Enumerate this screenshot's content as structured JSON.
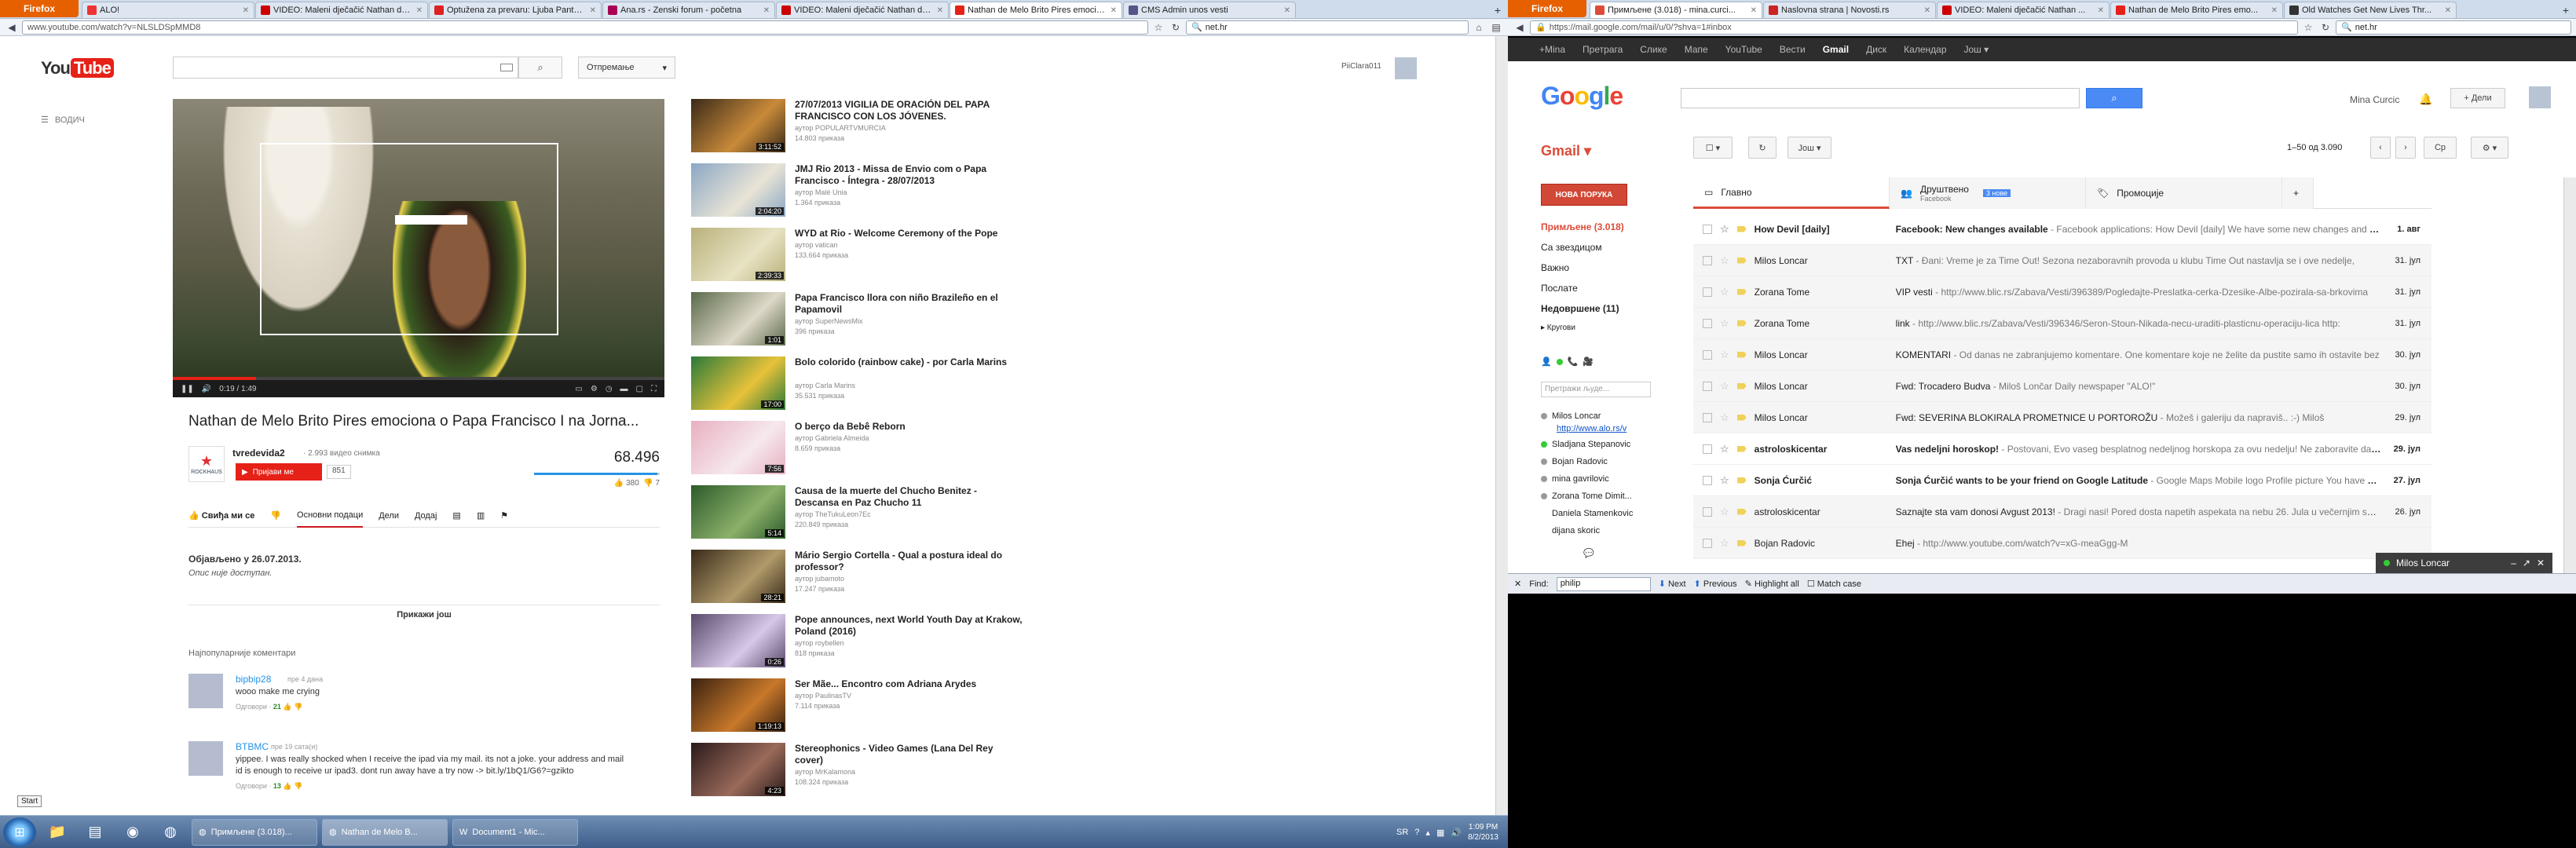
{
  "left": {
    "browser": {
      "firefox_label": "Firefox",
      "tabs": [
        {
          "title": "ALO!",
          "color": "#e33"
        },
        {
          "title": "VIDEO: Maleni dječačić Nathan de ...",
          "color": "#c00"
        },
        {
          "title": "Optužena za prevaru: Ljuba Pantovi...",
          "color": "#d22"
        },
        {
          "title": "Ana.rs - Zenski forum - početna",
          "color": "#a05"
        },
        {
          "title": "VIDEO: Maleni dječačić Nathan de ...",
          "color": "#c00"
        },
        {
          "title": "Nathan de Melo Brito Pires emocio...",
          "color": "#e62117",
          "active": true
        },
        {
          "title": "CMS Admin unos vesti",
          "color": "#558"
        }
      ],
      "url": "www.youtube.com/watch?v=NLSLDSpMMD8",
      "search_value": "net.hr"
    },
    "youtube": {
      "logo_you": "You",
      "logo_tube": "Tube",
      "upload_label": "Отпремање",
      "user_name": "PiiClara011",
      "menu_label": "ВОДИЧ",
      "player": {
        "time": "0:19 / 1:49",
        "progress": 0.17
      },
      "title": "Nathan de Melo Brito Pires emociona o Papa Francisco I na Jorna...",
      "channel": {
        "logo_text": "ROCKHAUS",
        "name": "tvredevida2",
        "videos": "· 2.993 видео снимка",
        "subscribe": "Пријави ме",
        "subs": "851",
        "views": "68.496",
        "likes": "380",
        "dislikes": "7",
        "like_ratio": 0.98
      },
      "actions": {
        "like": "Свиђа ми се",
        "about": "Основни подаци",
        "share": "Дели",
        "add": "Додај"
      },
      "published": "Објављено у 26.07.2013.",
      "description": "Опис није доступан.",
      "show_more": "Прикажи још",
      "comments_header": "Најпопуларније коментари",
      "comments": [
        {
          "user": "bipbip28",
          "ago": "пре 4 дана",
          "text": "wooo make me crying",
          "reply": "Одговори ·",
          "score": "21"
        },
        {
          "user": "BTBMC",
          "ago": "пре 19 сата(и)",
          "text": "yippee. I was really shocked when I receive the ipad via my mail. its not a joke. your address and mail id is enough to receive ur ipad3. dont run away have a try now -> bit.ly/1bQ1/G6?=gzikto",
          "reply": "Одговори ·",
          "score": "13"
        }
      ],
      "related": [
        {
          "title": "27/07/2013 VIGILIA DE ORACIÓN DEL PAPA FRANCISCO CON LOS JÓVENES.",
          "author": "аутор POPULARTVMURCIA",
          "views": "14.803 приказа",
          "dur": "3:11:52",
          "c1": "#3a2a18",
          "c2": "#c98a3a"
        },
        {
          "title": "JMJ Rio 2013 - Missa de Envio com o Papa Francisco - Íntegra - 28/07/2013",
          "author": "аутор Malé Unia",
          "views": "1.364 приказа",
          "dur": "2:04:20",
          "c1": "#8aa7c4",
          "c2": "#e9e4d6"
        },
        {
          "title": "WYD at Rio - Welcome Ceremony of the Pope",
          "author": "аутор vatican",
          "views": "133.664 приказа",
          "dur": "2:39:33",
          "c1": "#b9b07a",
          "c2": "#e7e3c3"
        },
        {
          "title": "Papa Francisco llora con niño Brazileño en el Papamovil",
          "author": "аутор SuperNewsMix",
          "views": "396 приказа",
          "dur": "1:01",
          "c1": "#5a6a4a",
          "c2": "#ded8c8"
        },
        {
          "title": "Bolo colorido (rainbow cake) - por Carla Marins",
          "author": "аутор Carla Marins",
          "views": "35.531 приказа",
          "dur": "17:00",
          "c1": "#2a7a3a",
          "c2": "#e8c23a"
        },
        {
          "title": "O berço da Bebê Reborn",
          "author": "аутор Gabriela Almeida",
          "views": "8.659 приказа",
          "dur": "7:56",
          "c1": "#e8b0c0",
          "c2": "#f6e8ee"
        },
        {
          "title": "Causa de la muerte del Chucho Benitez - Descansa en Paz Chucho 11",
          "author": "аутор TheTukuLeon7Ec",
          "views": "220.849 приказа",
          "dur": "5:14",
          "c1": "#2c5a2a",
          "c2": "#8bb06a"
        },
        {
          "title": "Mário Sergio Cortella - Qual a postura ideal do professor?",
          "author": "аутор jubamoto",
          "views": "17.247 приказа",
          "dur": "28:21",
          "c1": "#3a2a1a",
          "c2": "#b09a6a"
        },
        {
          "title": "Pope announces, next World Youth Day at Krakow, Poland (2016)",
          "author": "аутор roybellen",
          "views": "818 приказа",
          "dur": "0:26",
          "c1": "#5a4a6a",
          "c2": "#d8c8e8"
        },
        {
          "title": "Ser Mãe... Encontro com Adriana Arydes",
          "author": "аутор PaulinasTV",
          "views": "7.114 приказа",
          "dur": "1:19:13",
          "c1": "#3a2210",
          "c2": "#c8782a"
        },
        {
          "title": "Stereophonics - Video Games (Lana Del Rey cover)",
          "author": "аутор MrKalamona",
          "views": "108.324 приказа",
          "dur": "4:23",
          "c1": "#2a1a1a",
          "c2": "#9a6a5a"
        }
      ],
      "start_label": "Start"
    },
    "taskbar": {
      "apps": [
        {
          "label": "Примљене (3.018)..."
        },
        {
          "label": "Nathan de Melo B...",
          "active": true
        },
        {
          "label": "Document1 - Mic..."
        }
      ],
      "lang": "SR",
      "time": "1:09 PM",
      "date": "8/2/2013"
    }
  },
  "right": {
    "browser": {
      "firefox_label": "Firefox",
      "tabs": [
        {
          "title": "Примљене (3.018) - mina.curci...",
          "color": "#dd4b39",
          "active": true
        },
        {
          "title": "Naslovna strana | Novosti.rs",
          "color": "#c22"
        },
        {
          "title": "VIDEO: Maleni dječačić Nathan ...",
          "color": "#c00"
        },
        {
          "title": "Nathan de Melo Brito Pires emo...",
          "color": "#e62117"
        },
        {
          "title": "Old Watches Get New Lives Thr...",
          "color": "#333"
        }
      ],
      "url": "https://mail.google.com/mail/u/0/?shva=1#inbox",
      "search_value": "net.hr"
    },
    "gbar": [
      "+Mina",
      "Претрага",
      "Слике",
      "Мапе",
      "YouTube",
      "Вести",
      "Gmail",
      "Диск",
      "Календар",
      "Још ▾"
    ],
    "gbar_selected": "Gmail",
    "gmail": {
      "logo": [
        "G",
        "o",
        "o",
        "g",
        "l",
        "e"
      ],
      "logo_colors": [
        "#4285f4",
        "#ea4335",
        "#fbbc05",
        "#4285f4",
        "#34a853",
        "#ea4335"
      ],
      "user": "Mina Curcic",
      "share": "+ Дели",
      "title": "Gmail ▾",
      "more": "Још ▾",
      "pagination": "1–50 од 3.090",
      "lang_btn": "Ср",
      "compose": "НОВА ПОРУКА",
      "nav": [
        {
          "label": "Примљене (3.018)",
          "style": "red"
        },
        {
          "label": "Са звездицом",
          "style": ""
        },
        {
          "label": "Важно",
          "style": ""
        },
        {
          "label": "Послате",
          "style": ""
        },
        {
          "label": "Недовршене (11)",
          "style": "bold"
        },
        {
          "label": "▸ Кругови",
          "style": ""
        }
      ],
      "chat_search": "Претражи људе...",
      "contacts": [
        {
          "name": "Milos Loncar",
          "color": "#999",
          "link": "http://www.alo.rs/v"
        },
        {
          "name": "Sladjana Stepanovic",
          "color": "#3c3"
        },
        {
          "name": "Bojan Radovic",
          "color": "#999"
        },
        {
          "name": "mina gavrilovic",
          "color": "#999"
        },
        {
          "name": "Zorana Tome Dimit...",
          "color": "#999"
        },
        {
          "name": "Daniela Stamenkovic",
          "color": ""
        },
        {
          "name": "dijana skoric",
          "color": ""
        }
      ],
      "tabs": [
        {
          "label": "Главно",
          "sub": ""
        },
        {
          "label": "Друштвено",
          "sub": "Facebook",
          "badge": "3 нове"
        },
        {
          "label": "Промоције",
          "sub": ""
        }
      ],
      "mails": [
        {
          "sender": "How Devil [daily]",
          "subject": "Facebook: New changes available",
          "snippet": " - Facebook applications: How Devil [daily] We have some new changes and feat",
          "date": "1. авг",
          "unread": true
        },
        {
          "sender": "Milos Loncar",
          "subject": "TXT",
          "snippet": " - Đani: Vreme je za Time Out! Sezona nezaboravnih provoda u klubu Time Out nastavlja se i ove nedelje,",
          "date": "31. јул",
          "unread": false
        },
        {
          "sender": "Zorana Tome",
          "subject": "VIP vesti",
          "snippet": " - http://www.blic.rs/Zabava/Vesti/396389/Pogledajte-Preslatka-cerka-Dzesike-Albe-pozirala-sa-brkovima",
          "date": "31. јул",
          "unread": false
        },
        {
          "sender": "Zorana Tome",
          "subject": "link",
          "snippet": " - http://www.blic.rs/Zabava/Vesti/396346/Seron-Stoun-Nikada-necu-uraditi-plasticnu-operaciju-lica http:",
          "date": "31. јул",
          "unread": false
        },
        {
          "sender": "Milos Loncar",
          "subject": "KOMENTARI",
          "snippet": " - Od danas ne zabranjujemo komentare. One komentare koje ne želite da pustite samo ih ostavite bez",
          "date": "30. јул",
          "unread": false
        },
        {
          "sender": "Milos Loncar",
          "subject": "Fwd: Trocadero Budva",
          "snippet": " - Miloš Lončar Daily newspaper \"ALO!\"",
          "date": "30. јул",
          "unread": false
        },
        {
          "sender": "Milos Loncar",
          "subject": "Fwd: SEVERINA BLOKIRALA PROMETNICE U PORTOROŽU",
          "snippet": " - Možeš i galeriju da napraviš.. :-) Miloš",
          "date": "29. јул",
          "unread": false
        },
        {
          "sender": "astroloskicentar",
          "subject": "Vas nedeljni horoskop!",
          "snippet": " - Postovani, Evo vaseg besplatnog nedeljnog horskopa za ovu nedelju! Ne zaboravite da pose",
          "date": "29. јул",
          "unread": true
        },
        {
          "sender": "Sonja Ćurčić",
          "subject": "Sonja Ćurčić wants to be your friend on Google Latitude",
          "snippet": " - Google Maps Mobile logo Profile picture You have bee",
          "date": "27. јул",
          "unread": true
        },
        {
          "sender": "astroloskicentar",
          "subject": "Saznajte sta vam donosi Avgust 2013!",
          "snippet": " - Dragi nasi! Pored dosta napetih aspekata na nebu 26. Jula u večernjim satima",
          "date": "26. јул",
          "unread": false
        },
        {
          "sender": "Bojan Radovic",
          "subject": "Ehej",
          "snippet": " - http://www.youtube.com/watch?v=xG-meaGgg-M",
          "date": "",
          "unread": false
        }
      ],
      "chat_window": "Milos Loncar"
    },
    "findbar": {
      "label": "Find:",
      "value": "philip",
      "next": "Next",
      "previous": "Previous",
      "highlight": "Highlight all",
      "match_case": "Match case"
    }
  }
}
